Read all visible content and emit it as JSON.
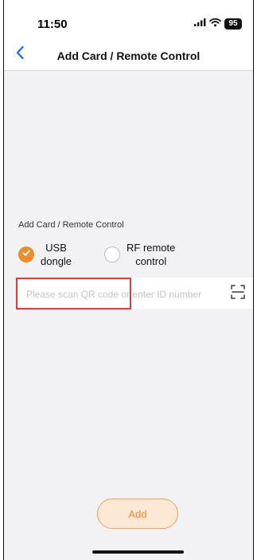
{
  "status_bar": {
    "time": "11:50",
    "battery": "95"
  },
  "nav": {
    "title": "Add Card / Remote Control"
  },
  "form": {
    "section_label": "Add Card / Remote Control",
    "options": [
      {
        "label": "USB\ndongle",
        "selected": true
      },
      {
        "label": "RF remote\ncontrol",
        "selected": false
      }
    ],
    "id_input": {
      "value": "",
      "placeholder": "Please scan QR code or enter ID number"
    }
  },
  "actions": {
    "add_label": "Add"
  },
  "colors": {
    "accent": "#f08a2b",
    "accent_light": "#fde8d6",
    "background": "#f2f2f5",
    "highlight": "#e53935"
  },
  "icons": {
    "back": "chevron-left-icon",
    "scan": "scan-frame-icon",
    "signal": "signal-icon",
    "wifi": "wifi-icon",
    "battery": "battery-icon",
    "check": "check-icon"
  }
}
